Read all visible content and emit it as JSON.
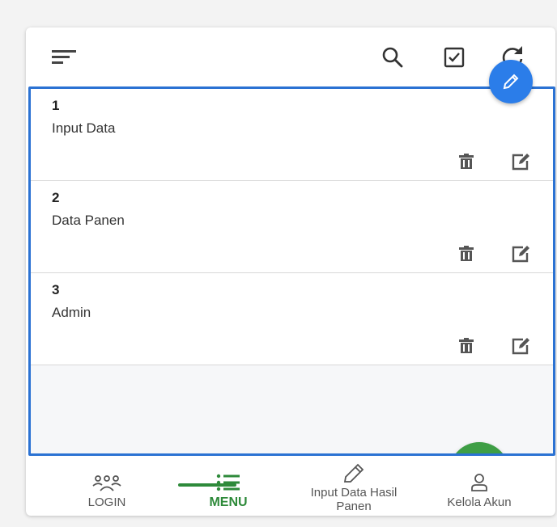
{
  "toolbar": {
    "icons": [
      "menu-icon",
      "search-icon",
      "checkbox-icon",
      "refresh-icon",
      "pencil-icon"
    ]
  },
  "list": {
    "items": [
      {
        "number": "1",
        "title": "Input Data"
      },
      {
        "number": "2",
        "title": "Data Panen"
      },
      {
        "number": "3",
        "title": "Admin"
      }
    ],
    "row_action_icons": [
      "trash-icon",
      "edit-icon"
    ],
    "add_icon": "plus-icon"
  },
  "nav": {
    "login": "LOGIN",
    "menu": "MENU",
    "input_data": "Input Data Hasil Panen",
    "kelola": "Kelola Akun"
  },
  "colors": {
    "accent_blue": "#2b7de9",
    "frame_blue": "#2b72d3",
    "fab_green": "#3e9e45",
    "active_green": "#2e8a3a"
  }
}
